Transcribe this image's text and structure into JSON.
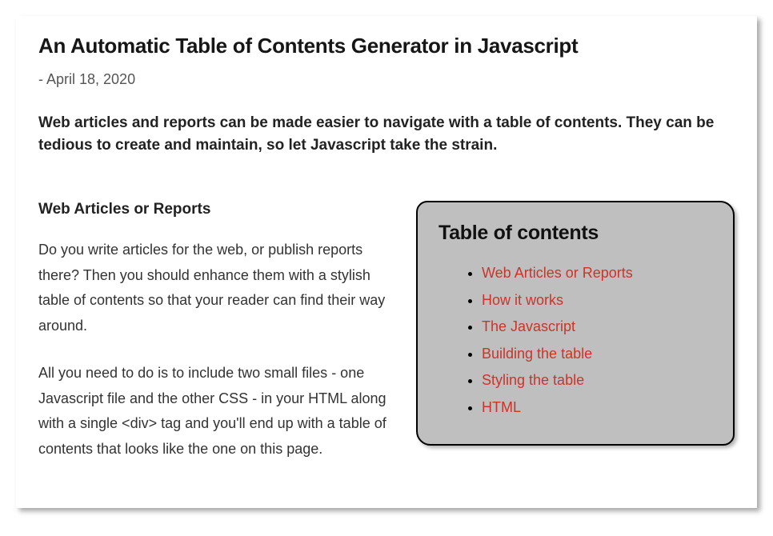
{
  "article": {
    "title": "An Automatic Table of Contents Generator in Javascript",
    "date": "- April 18, 2020",
    "lead": "Web articles and reports can be made easier to navigate with a table of contents. They can be tedious to create and maintain, so let Javascript take the strain.",
    "section_heading": "Web Articles or Reports",
    "para1": "Do you write articles for the web, or publish reports there? Then you should enhance them with a stylish table of contents so that your reader can find their way around.",
    "para2": "All you need to do is to include two small files - one Javascript file and the other CSS - in your HTML along with a single <div> tag and you'll end up with a table of contents that looks like the one on this page."
  },
  "toc": {
    "title": "Table of contents",
    "items": [
      "Web Articles or Reports",
      "How it works",
      "The Javascript",
      "Building the table",
      "Styling the table",
      "HTML"
    ]
  }
}
